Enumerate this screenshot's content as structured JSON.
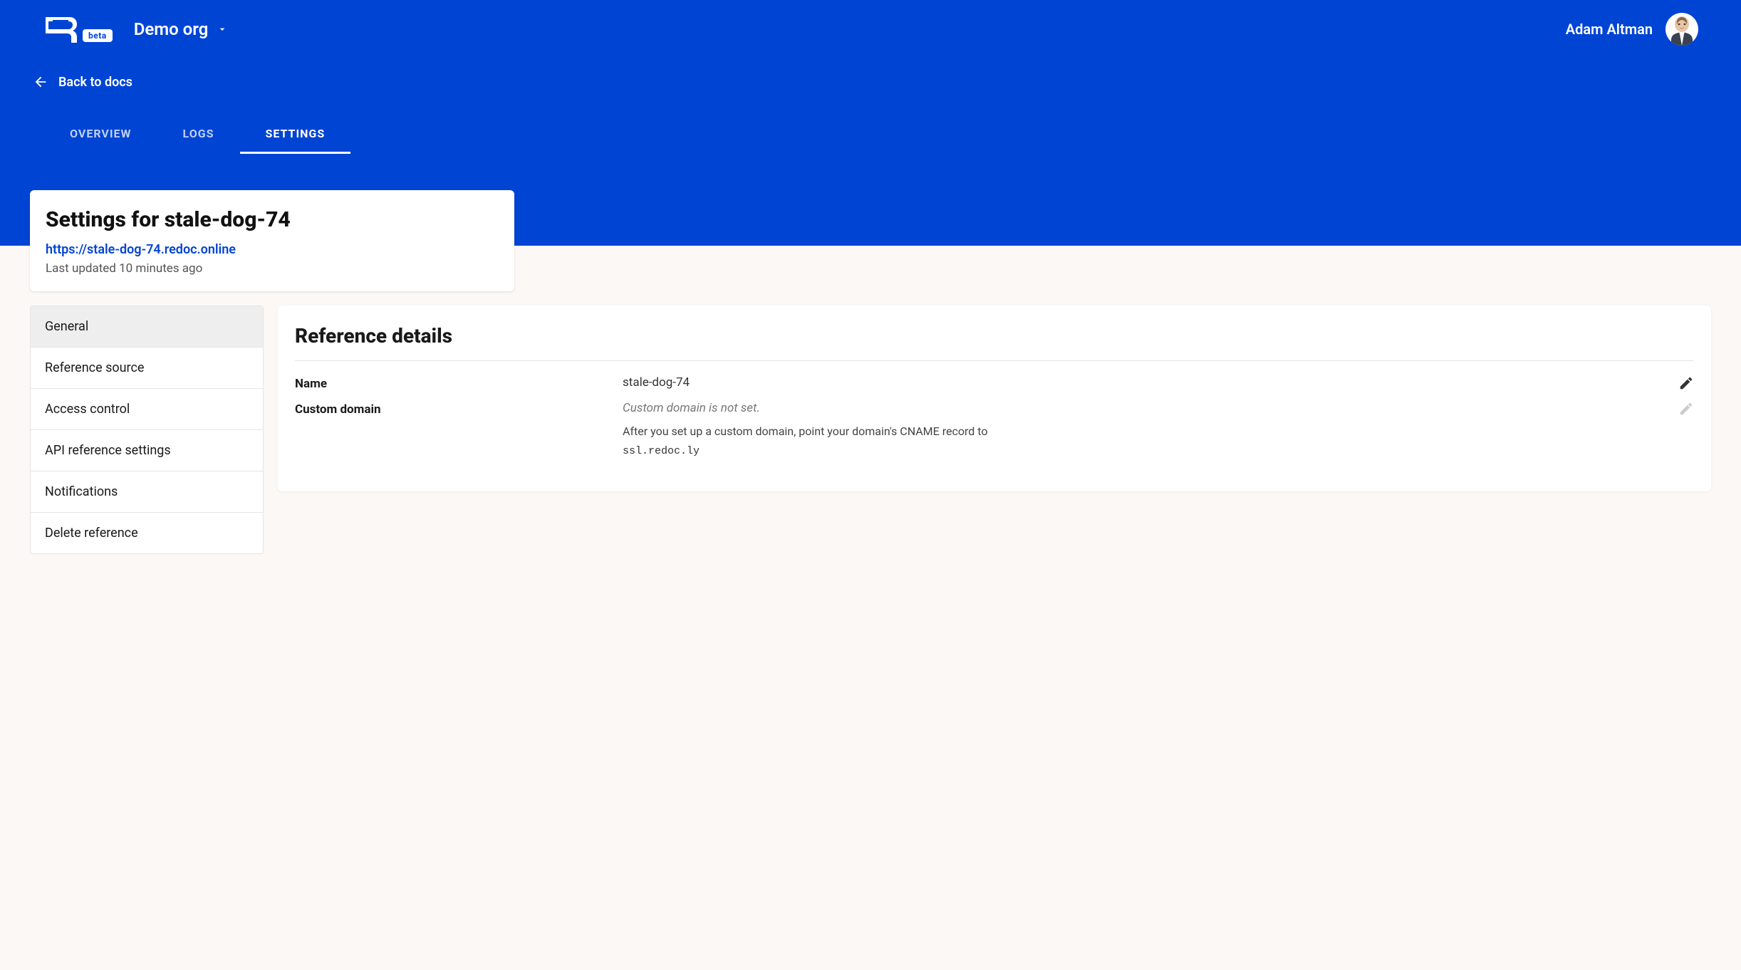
{
  "header": {
    "beta_label": "beta",
    "org_name": "Demo org",
    "user_name": "Adam Altman"
  },
  "back_link": "Back to docs",
  "tabs": [
    {
      "label": "OVERVIEW",
      "active": false
    },
    {
      "label": "LOGS",
      "active": false
    },
    {
      "label": "SETTINGS",
      "active": true
    }
  ],
  "title_card": {
    "heading": "Settings for stale-dog-74",
    "url": "https://stale-dog-74.redoc.online",
    "updated": "Last updated 10 minutes ago"
  },
  "sidenav": [
    {
      "label": "General",
      "active": true
    },
    {
      "label": "Reference source",
      "active": false
    },
    {
      "label": "Access control",
      "active": false
    },
    {
      "label": "API reference settings",
      "active": false
    },
    {
      "label": "Notifications",
      "active": false
    },
    {
      "label": "Delete reference",
      "active": false
    }
  ],
  "details": {
    "heading": "Reference details",
    "name_label": "Name",
    "name_value": "stale-dog-74",
    "domain_label": "Custom domain",
    "domain_not_set": "Custom domain is not set.",
    "domain_hint_pre": "After you set up a custom domain, point your domain's CNAME record to ",
    "domain_cname": "ssl.redoc.ly"
  }
}
